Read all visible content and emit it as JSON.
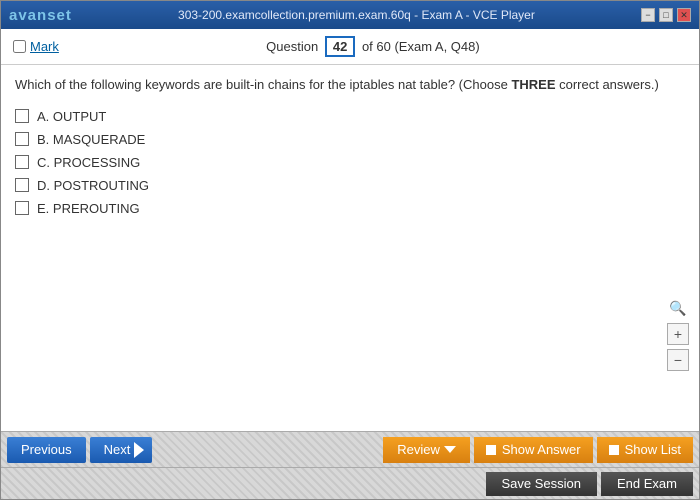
{
  "titlebar": {
    "logo_a": "avan",
    "logo_b": "set",
    "title": "303-200.examcollection.premium.exam.60q - Exam A - VCE Player",
    "btn_minimize": "−",
    "btn_maximize": "□",
    "btn_close": "✕"
  },
  "question_header": {
    "mark_label": "Mark",
    "question_label": "Question",
    "question_number": "42",
    "of_label": "of 60 (Exam A, Q48)"
  },
  "question": {
    "text_before": "Which of the following keywords are built-in chains for the iptables nat table? (Choose ",
    "text_bold": "THREE",
    "text_after": " correct answers.)",
    "options": [
      {
        "id": "A",
        "label": "A.  OUTPUT"
      },
      {
        "id": "B",
        "label": "B.  MASQUERADE"
      },
      {
        "id": "C",
        "label": "C.  PROCESSING"
      },
      {
        "id": "D",
        "label": "D.  POSTROUTING"
      },
      {
        "id": "E",
        "label": "E.  PREROUTING"
      }
    ]
  },
  "zoom": {
    "plus": "+",
    "minus": "−"
  },
  "toolbar": {
    "prev_label": "Previous",
    "next_label": "Next",
    "review_label": "Review",
    "show_answer_label": "Show Answer",
    "show_list_label": "Show List"
  },
  "footer": {
    "save_session_label": "Save Session",
    "end_exam_label": "End Exam"
  }
}
